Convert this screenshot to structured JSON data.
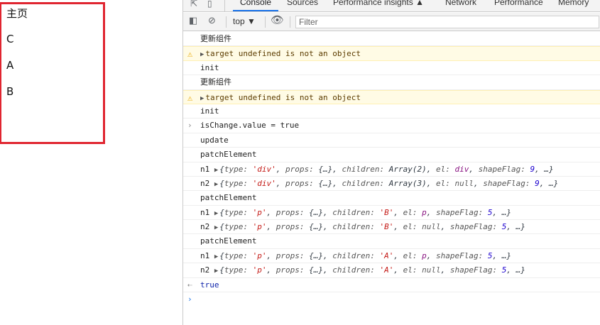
{
  "page": {
    "title": "主页",
    "items": [
      "C",
      "A",
      "B"
    ]
  },
  "devtools": {
    "tabs": [
      "Console",
      "Sources",
      "Performance insights",
      "Network",
      "Performance",
      "Memory"
    ],
    "performance_insights_badge": "▲",
    "toolbar": {
      "context": "top",
      "filter_placeholder": "Filter"
    },
    "colors": {
      "accent": "#1a73e8",
      "warning_bg": "#fffbe5",
      "page_border": "#e02530"
    }
  },
  "console": {
    "log1": "更新组件",
    "warn1": "target undefined is not an object",
    "log2": "init",
    "log3": "更新组件",
    "warn2": "target undefined is not an object",
    "log4": "init",
    "input1": "isChange.value = true",
    "log5": "update",
    "log6": "patchElement",
    "n1a": {
      "label": "n1",
      "type": "'div'",
      "props": "{…}",
      "children": "Array(2)",
      "el": "div",
      "shapeFlag": "9",
      "more": "…"
    },
    "n2a": {
      "label": "n2",
      "type": "'div'",
      "props": "{…}",
      "children": "Array(3)",
      "el": "null",
      "shapeFlag": "9",
      "more": "…"
    },
    "log7": "patchElement",
    "n1b": {
      "label": "n1",
      "type": "'p'",
      "props": "{…}",
      "children": "'B'",
      "el": "p",
      "shapeFlag": "5",
      "more": "…"
    },
    "n2b": {
      "label": "n2",
      "type": "'p'",
      "props": "{…}",
      "children": "'B'",
      "el": "null",
      "shapeFlag": "5",
      "more": "…"
    },
    "log8": "patchElement",
    "n1c": {
      "label": "n1",
      "type": "'p'",
      "props": "{…}",
      "children": "'A'",
      "el": "p",
      "shapeFlag": "5",
      "more": "…"
    },
    "n2c": {
      "label": "n2",
      "type": "'p'",
      "props": "{…}",
      "children": "'A'",
      "el": "null",
      "shapeFlag": "5",
      "more": "…"
    },
    "result": "true"
  }
}
